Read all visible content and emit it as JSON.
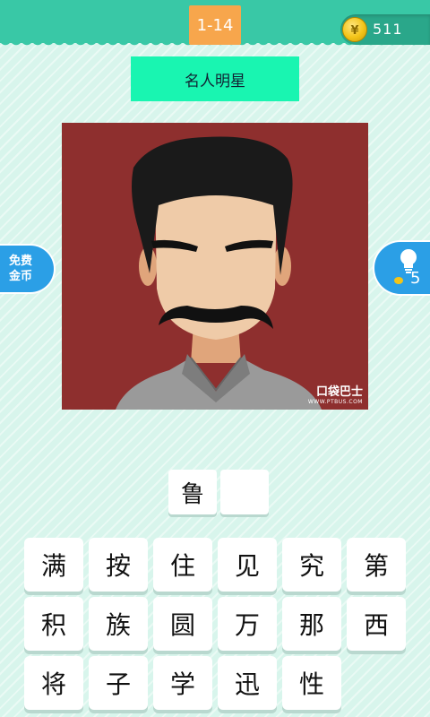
{
  "header": {
    "level": "1-14",
    "coins": "511"
  },
  "category": "名人明星",
  "image": {
    "watermark_brand": "口袋巴士",
    "watermark_url": "WWW.PTBUS.COM"
  },
  "side": {
    "free_coins": [
      "免费",
      "金币"
    ],
    "hint_count": "5"
  },
  "answer": [
    "鲁",
    ""
  ],
  "keys": [
    "满",
    "按",
    "住",
    "见",
    "究",
    "第",
    "积",
    "族",
    "圆",
    "万",
    "那",
    "西",
    "将",
    "子",
    "学",
    "迅",
    "性"
  ]
}
